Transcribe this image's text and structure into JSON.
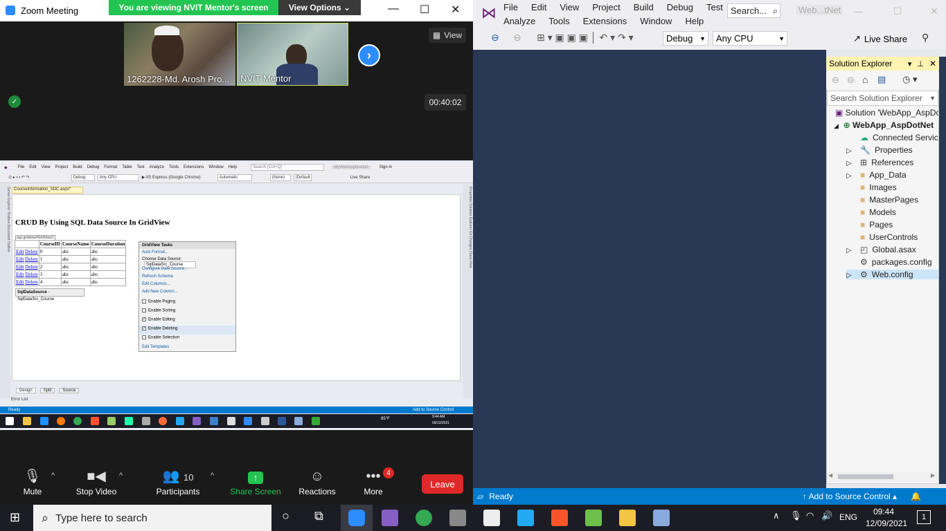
{
  "zoom": {
    "window_title": "Zoom Meeting",
    "viewing_banner": "You are viewing NVIT Mentor's screen",
    "view_options": "View Options",
    "view_label": "View",
    "timer": "00:40:02",
    "participants": [
      {
        "label": "1262228-Md. Arosh Pro..."
      },
      {
        "label": "NVIT Mentor"
      }
    ],
    "controls": {
      "mute": "Mute",
      "stop_video": "Stop Video",
      "participants": "Participants",
      "participant_count": "10",
      "share_screen": "Share Screen",
      "reactions": "Reactions",
      "more": "More",
      "more_badge": "4",
      "leave": "Leave"
    }
  },
  "shared": {
    "menu": [
      "File",
      "Edit",
      "View",
      "Project",
      "Build",
      "Debug",
      "Format",
      "Table",
      "Test",
      "Analyze",
      "Tools",
      "Extensions",
      "Window",
      "Help"
    ],
    "search_placeholder": "Search (Ctrl+Q)",
    "app_name": "MyWebApplication",
    "sign_in": "Sign in",
    "toolbar": {
      "config": "Debug",
      "platform": "Any CPU",
      "run": "IIS Express (Google Chrome)",
      "style": "Automatic",
      "none": "(None)",
      "default": "(Default"
    },
    "live_share": "Live Share",
    "doc_tab": "CourseInformation_SDC.aspx*",
    "left_strip": "Server Explorer  Toolbox  Document Outline",
    "right_strip": "Properties  Solution Explorer  Git Changes  Class View",
    "heading": "CRUD By Using SQL Data Source In GridView",
    "grid_tag": "asp:gridview#GridView1",
    "grid": {
      "headers": [
        "CourseID",
        "CourseName",
        "CourseDuration"
      ],
      "rows": [
        [
          "0",
          "abc",
          "abc"
        ],
        [
          "1",
          "abc",
          "abc"
        ],
        [
          "2",
          "abc",
          "abc"
        ],
        [
          "3",
          "abc",
          "abc"
        ],
        [
          "4",
          "abc",
          "abc"
        ]
      ],
      "edit": "Edit",
      "delete": "Delete"
    },
    "sqlsource": "SqlDataSource",
    "sqlsource_name": "SqlDataSrc_Course",
    "tasks": {
      "title": "GridView Tasks",
      "auto_format": "Auto Format...",
      "choose_label": "Choose Data Source:",
      "choose_value": "SqlDataSrc_Course",
      "links": [
        "Configure Data Source...",
        "Refresh Schema",
        "Edit Columns...",
        "Add New Column..."
      ],
      "checks": [
        {
          "label": "Enable Paging",
          "checked": false
        },
        {
          "label": "Enable Sorting",
          "checked": false
        },
        {
          "label": "Enable Editing",
          "checked": true
        },
        {
          "label": "Enable Deleting",
          "checked": true
        },
        {
          "label": "Enable Selection",
          "checked": false
        }
      ],
      "edit_templates": "Edit Templates"
    },
    "tabs": [
      "Design",
      "Split",
      "Source"
    ],
    "error_list": "Error List",
    "status": "Ready",
    "add_source": "Add to Source Control",
    "taskbar": {
      "temp": "85°F",
      "time": "9:44 AM",
      "date": "09/12/2021"
    }
  },
  "vs": {
    "menu_row1": [
      "File",
      "Edit",
      "View",
      "Project",
      "Build",
      "Debug",
      "Test"
    ],
    "menu_row2": [
      "Analyze",
      "Tools",
      "Extensions",
      "Window",
      "Help"
    ],
    "search_label": "Search...",
    "window_name": "Web...tNet",
    "config": "Debug",
    "platform": "Any CPU",
    "live_share": "Live Share",
    "solution_explorer": {
      "title": "Solution Explorer",
      "search_placeholder": "Search Solution Explorer",
      "solution": "Solution 'WebApp_AspDo",
      "project": "WebApp_AspDotNet",
      "items": [
        "Connected Service",
        "Properties",
        "References",
        "App_Data",
        "Images",
        "MasterPages",
        "Models",
        "Pages",
        "UserControls",
        "Global.asax",
        "packages.config",
        "Web.config"
      ]
    },
    "status": "Ready",
    "add_source": "Add to Source Control"
  },
  "taskbar": {
    "search_placeholder": "Type here to search",
    "lang": "ENG",
    "time": "09:44",
    "date": "12/09/2021",
    "notification_count": "1"
  },
  "colors": {
    "zoom_green": "#23c552",
    "zoom_blue": "#2d8cff",
    "leave_red": "#e02828",
    "vs_blue": "#007acc"
  }
}
